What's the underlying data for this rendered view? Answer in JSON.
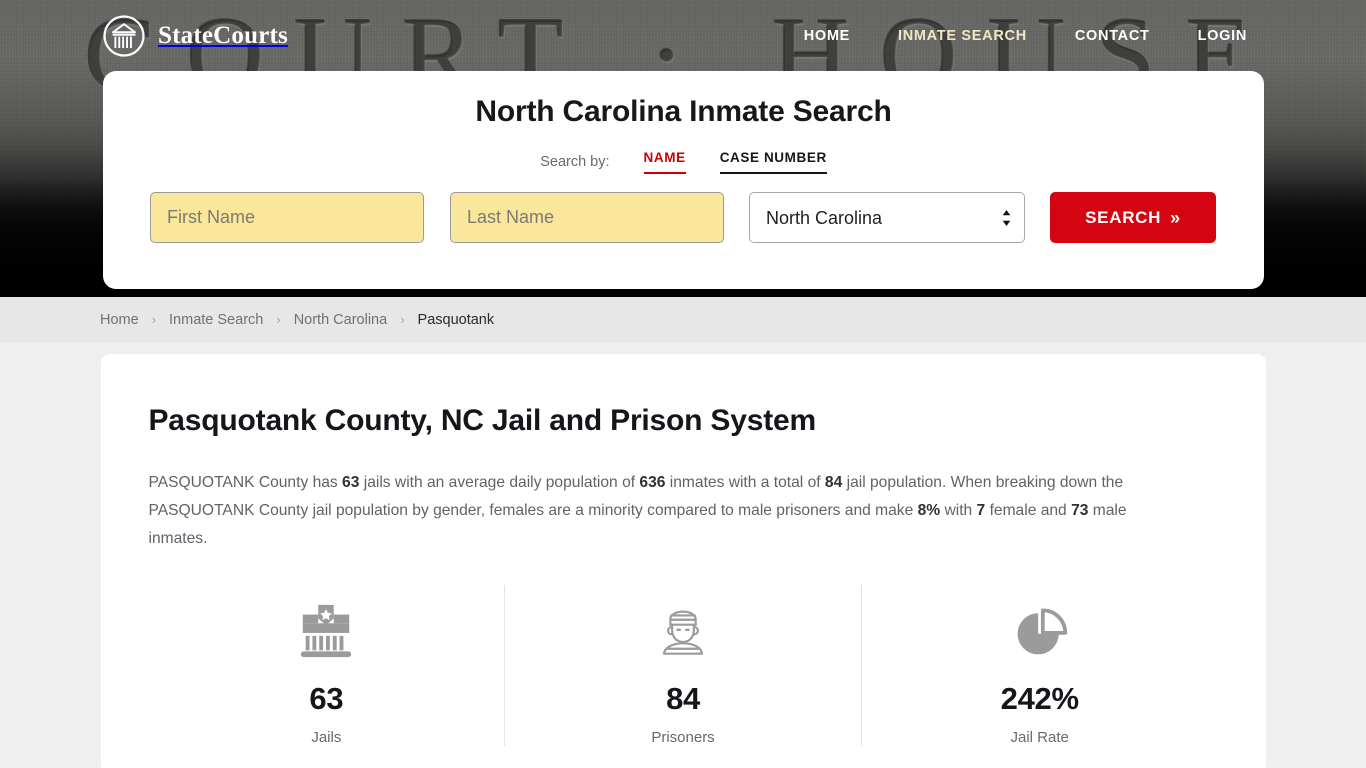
{
  "header": {
    "brand_name": "StateCourts",
    "brand_icon": "courthouse-circle-logo",
    "nav": [
      {
        "label": "HOME",
        "active": false
      },
      {
        "label": "INMATE SEARCH",
        "active": true
      },
      {
        "label": "CONTACT",
        "active": false
      },
      {
        "label": "LOGIN",
        "active": false
      }
    ],
    "hero_background_text": "COURT · HOUSE"
  },
  "search_panel": {
    "title": "North Carolina Inmate Search",
    "search_by_label": "Search by:",
    "tabs": [
      {
        "label": "NAME",
        "active": true,
        "color": "#cc0000"
      },
      {
        "label": "CASE NUMBER",
        "active": false,
        "color": "#17171a"
      }
    ],
    "first_name": {
      "placeholder": "First Name",
      "value": ""
    },
    "last_name": {
      "placeholder": "Last Name",
      "value": ""
    },
    "state_select": {
      "value": "North Carolina",
      "options": [
        "North Carolina"
      ]
    },
    "search_button": {
      "label": "SEARCH",
      "chevrons": "»",
      "color": "#d40511"
    }
  },
  "breadcrumb": {
    "items": [
      {
        "label": "Home",
        "current": false
      },
      {
        "label": "Inmate Search",
        "current": false
      },
      {
        "label": "North Carolina",
        "current": false
      },
      {
        "label": "Pasquotank",
        "current": true
      }
    ],
    "separator": "›"
  },
  "main": {
    "page_title": "Pasquotank County, NC Jail and Prison System",
    "intro": {
      "segments": [
        {
          "text": "PASQUOTANK County has ",
          "bold": false
        },
        {
          "text": "63",
          "bold": true
        },
        {
          "text": " jails with an average daily population of ",
          "bold": false
        },
        {
          "text": "636",
          "bold": true
        },
        {
          "text": " inmates with a total of ",
          "bold": false
        },
        {
          "text": "84",
          "bold": true
        },
        {
          "text": " jail population. When breaking down the PASQUOTANK County jail population by gender, females are a minority compared to male prisoners and make ",
          "bold": false
        },
        {
          "text": "8%",
          "bold": true
        },
        {
          "text": " with ",
          "bold": false
        },
        {
          "text": "7",
          "bold": true
        },
        {
          "text": " female and ",
          "bold": false
        },
        {
          "text": "73",
          "bold": true
        },
        {
          "text": " male inmates.",
          "bold": false
        }
      ]
    },
    "stats": [
      {
        "icon": "jail-building-badge-icon",
        "value": "63",
        "label": "Jails"
      },
      {
        "icon": "prisoner-icon",
        "value": "84",
        "label": "Prisoners"
      },
      {
        "icon": "pie-chart-icon",
        "value": "242%",
        "label": "Jail Rate"
      }
    ]
  }
}
